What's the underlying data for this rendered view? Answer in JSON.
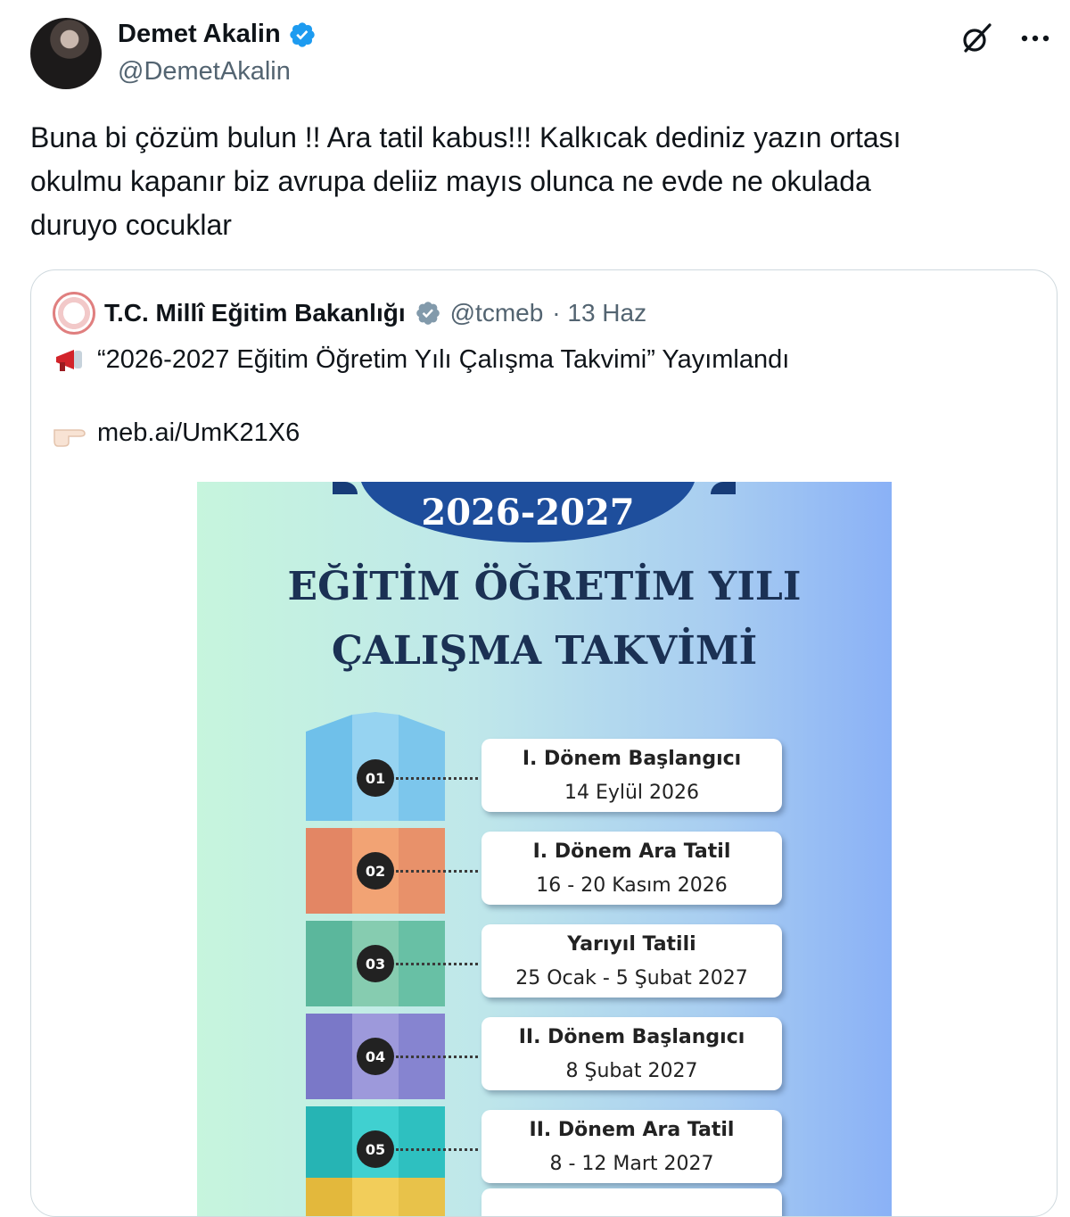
{
  "author": {
    "name": "Demet Akalin",
    "handle": "@DemetAkalin",
    "verified_icon": "verified-badge-icon"
  },
  "tweet": {
    "lines": [
      "Buna bi çözüm bulun !! Ara tatil kabus!!!  Kalkıcak dediniz yazın ortası",
      "okulmu kapanır biz avrupa deliiz mayıs olunca ne evde ne okulada",
      "duruyo cocuklar"
    ]
  },
  "quoted": {
    "name": "T.C. Millî Eğitim Bakanlığı",
    "handle": "@tcmeb",
    "meta": "· 13 Haz",
    "text": "“2026-2027 Eğitim Öğretim Yılı Çalışma Takvimi” Yayımlandı",
    "link": "meb.ai/UmK21X6"
  },
  "poster": {
    "year": "2026-2027",
    "title_line1": "EĞİTİM ÖĞRETİM YILI",
    "title_line2": "ÇALIŞMA TAKVİMİ",
    "items": [
      {
        "num": "01",
        "title": "I. Dönem Başlangıcı",
        "date": "14 Eylül 2026",
        "colors": [
          "#6fc0ea",
          "#96d3f1",
          "#7cc6ec"
        ]
      },
      {
        "num": "02",
        "title": "I. Dönem Ara Tatil",
        "date": "16 - 20 Kasım 2026",
        "colors": [
          "#e38664",
          "#f2a374",
          "#e8916a"
        ]
      },
      {
        "num": "03",
        "title": "Yarıyıl Tatili",
        "date": "25 Ocak - 5 Şubat 2027",
        "colors": [
          "#5bb79c",
          "#86ccb0",
          "#68c0a5"
        ]
      },
      {
        "num": "04",
        "title": "II. Dönem Başlangıcı",
        "date": "8 Şubat 2027",
        "colors": [
          "#7a78c8",
          "#9d99db",
          "#8684d0"
        ]
      },
      {
        "num": "05",
        "title": "II. Dönem Ara Tatil",
        "date": "8 - 12 Mart 2027",
        "colors": [
          "#26b4b4",
          "#40d0d0",
          "#2ec0c0"
        ]
      }
    ]
  }
}
